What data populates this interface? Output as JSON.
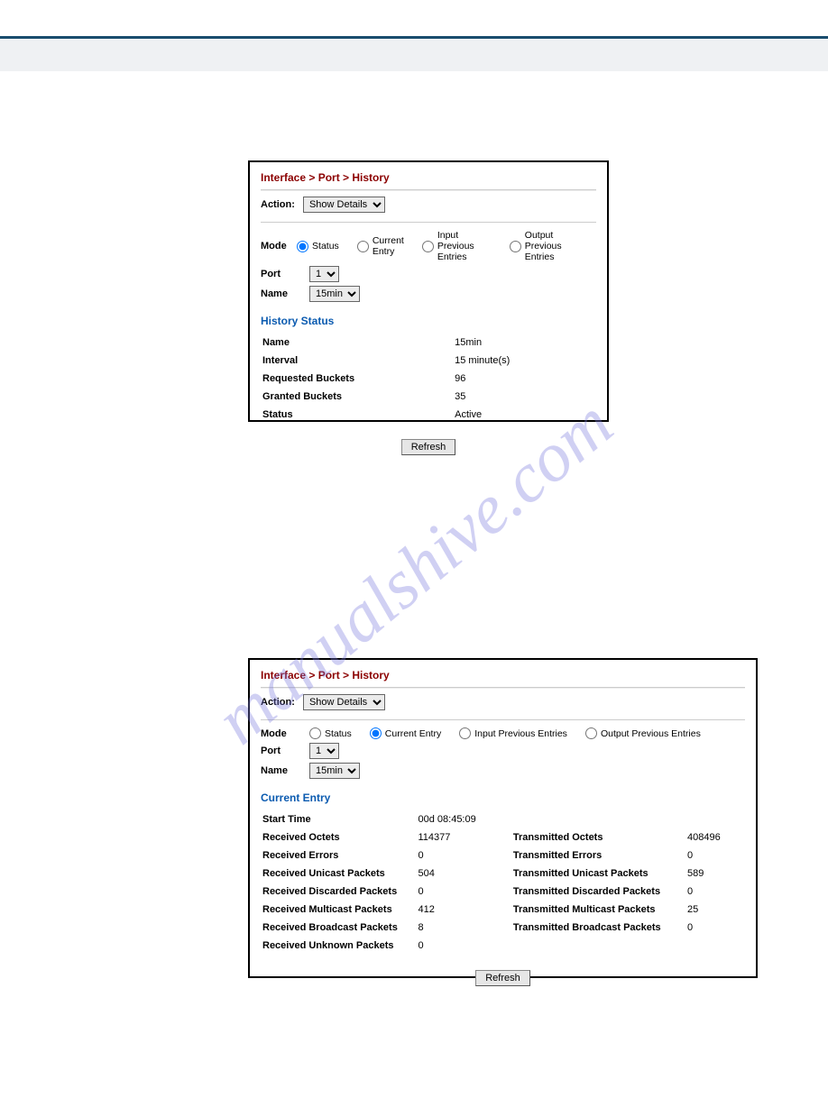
{
  "watermark": "manualshive.com",
  "breadcrumb": "Interface > Port > History",
  "action_label": "Action:",
  "action_value": "Show Details",
  "mode_label": "Mode",
  "mode_options": {
    "status": "Status",
    "current": "Current Entry",
    "input_prev": "Input Previous Entries",
    "output_prev": "Output Previous Entries"
  },
  "port_label": "Port",
  "port_value": "1",
  "name_label": "Name",
  "name_value": "15min",
  "refresh_label": "Refresh",
  "panel1": {
    "section": "History Status",
    "rows": {
      "name_k": "Name",
      "name_v": "15min",
      "interval_k": "Interval",
      "interval_v": "15 minute(s)",
      "req_k": "Requested Buckets",
      "req_v": "96",
      "grant_k": "Granted Buckets",
      "grant_v": "35",
      "status_k": "Status",
      "status_v": "Active"
    }
  },
  "panel2": {
    "section": "Current Entry",
    "rows": {
      "start_k": "Start Time",
      "start_v": "00d 08:45:09",
      "roct_k": "Received Octets",
      "roct_v": "114377",
      "toct_k": "Transmitted Octets",
      "toct_v": "408496",
      "rerr_k": "Received Errors",
      "rerr_v": "0",
      "terr_k": "Transmitted Errors",
      "terr_v": "0",
      "runi_k": "Received Unicast Packets",
      "runi_v": "504",
      "tuni_k": "Transmitted Unicast Packets",
      "tuni_v": "589",
      "rdisc_k": "Received Discarded Packets",
      "rdisc_v": "0",
      "tdisc_k": "Transmitted Discarded Packets",
      "tdisc_v": "0",
      "rmul_k": "Received Multicast Packets",
      "rmul_v": "412",
      "tmul_k": "Transmitted Multicast Packets",
      "tmul_v": "25",
      "rbro_k": "Received Broadcast Packets",
      "rbro_v": "8",
      "tbro_k": "Transmitted Broadcast Packets",
      "tbro_v": "0",
      "runk_k": "Received Unknown Packets",
      "runk_v": "0"
    }
  }
}
